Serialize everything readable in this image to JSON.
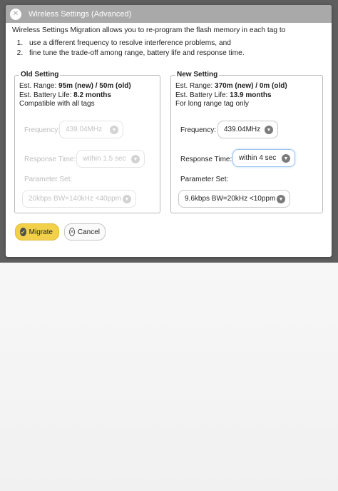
{
  "dialog": {
    "title": "Wireless Settings (Advanced)",
    "close_icon": "close-icon",
    "intro": "Wireless Settings Migration allows you to re-program the flash memory in each tag to",
    "intro_items": [
      "use a different frequency to resolve interference problems, and",
      "fine tune the trade-off among range, battery life and response time."
    ]
  },
  "old_setting": {
    "legend": "Old Setting",
    "range_label": "Est. Range: ",
    "range_value": "95m (new) / 50m (old)",
    "battery_label": "Est. Battery Life: ",
    "battery_value": "8.2 months",
    "note": "Compatible with all tags",
    "frequency_label": "Frequency:",
    "frequency_value": "439.04MHz",
    "response_label": "Response Time:",
    "response_value": "within 1.5 sec",
    "param_label": "Parameter Set:",
    "param_value": "20kbps BW=140kHz <40ppm"
  },
  "new_setting": {
    "legend": "New Setting",
    "range_label": "Est. Range: ",
    "range_value": "370m (new) / 0m (old)",
    "battery_label": "Est. Battery Life: ",
    "battery_value": "13.9 months",
    "note": "For long range tag only",
    "frequency_label": "Frequency:",
    "frequency_value": "439.04MHz",
    "response_label": "Response Time:",
    "response_value": "within 4 sec",
    "param_label": "Parameter Set:",
    "param_value": "9.6kbps BW=20kHz <10ppm"
  },
  "buttons": {
    "migrate": "Migrate",
    "cancel": "Cancel"
  },
  "colors": {
    "titlebar": "#a9a9a9",
    "migrate_button": "#f2d04a",
    "focus_ring": "#9ec4ee"
  }
}
